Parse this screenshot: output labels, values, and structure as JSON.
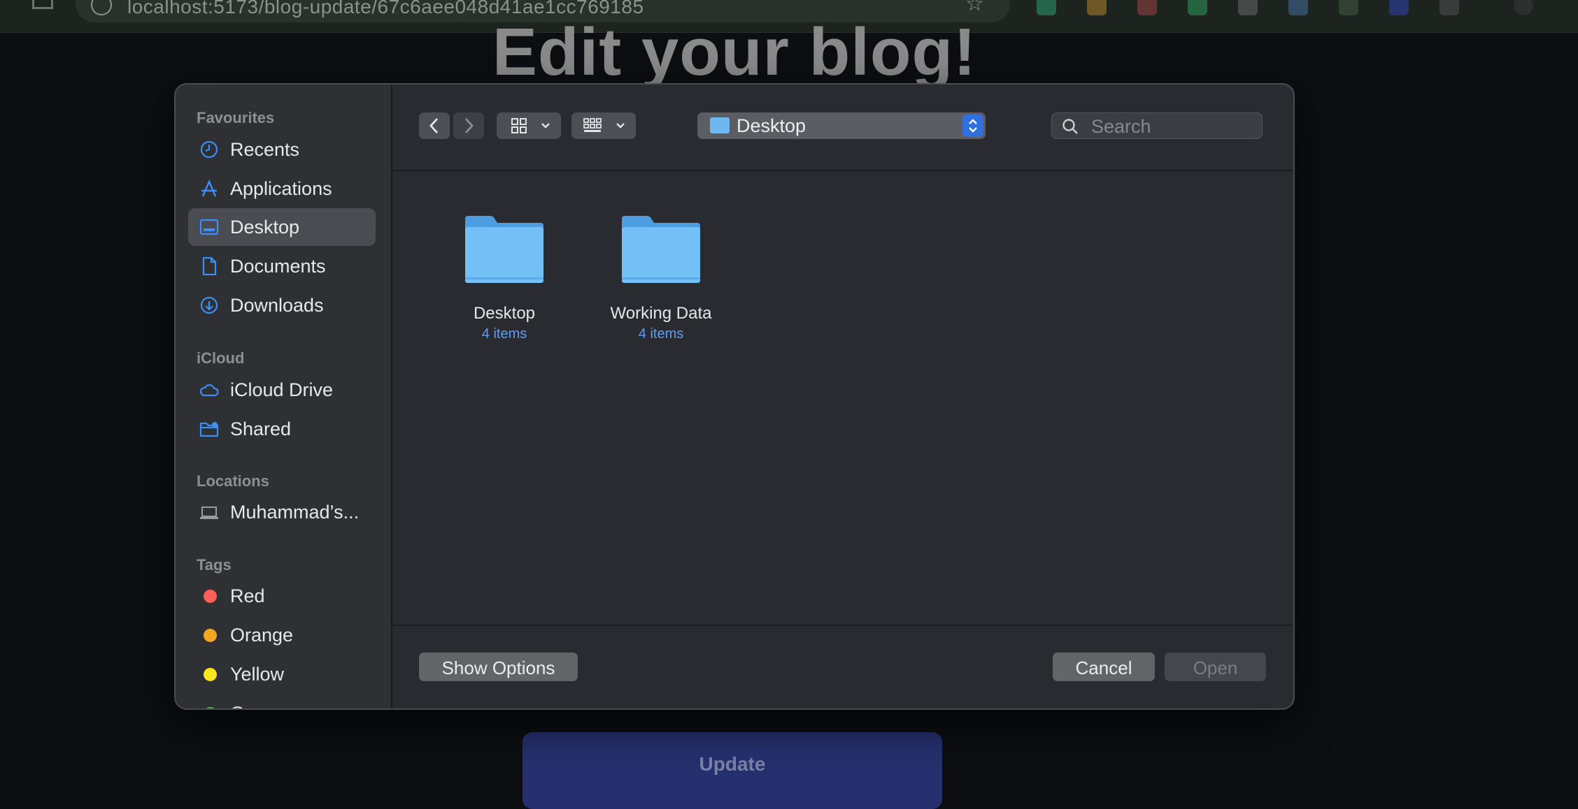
{
  "browser": {
    "url": "localhost:5173/blog-update/67c6aee048d41ae1cc769185"
  },
  "page": {
    "heading": "Edit your blog!",
    "update_label": "Update"
  },
  "dialog": {
    "sidebar": {
      "favourites_heading": "Favourites",
      "favourites": [
        {
          "label": "Recents",
          "icon": "clock-icon"
        },
        {
          "label": "Applications",
          "icon": "applications-icon"
        },
        {
          "label": "Desktop",
          "icon": "desktop-icon",
          "selected": true
        },
        {
          "label": "Documents",
          "icon": "document-icon"
        },
        {
          "label": "Downloads",
          "icon": "download-icon"
        }
      ],
      "icloud_heading": "iCloud",
      "icloud": [
        {
          "label": "iCloud Drive",
          "icon": "cloud-icon"
        },
        {
          "label": "Shared",
          "icon": "shared-folder-icon"
        }
      ],
      "locations_heading": "Locations",
      "locations": [
        {
          "label": "Muhammad’s...",
          "icon": "laptop-icon"
        }
      ],
      "tags_heading": "Tags",
      "tags": [
        {
          "label": "Red",
          "color": "#ff5f57"
        },
        {
          "label": "Orange",
          "color": "#f5a623"
        },
        {
          "label": "Yellow",
          "color": "#f8e71c"
        },
        {
          "label": "Green",
          "color": "#28c840"
        }
      ]
    },
    "toolbar": {
      "location": "Desktop",
      "search_placeholder": "Search"
    },
    "files": [
      {
        "name": "Desktop",
        "count": "4 items"
      },
      {
        "name": "Working Data",
        "count": "4 items"
      }
    ],
    "buttons": {
      "show_options": "Show Options",
      "cancel": "Cancel",
      "open": "Open"
    },
    "colors": {
      "accent": "#2f6fde",
      "folder": "#6fb8ef",
      "sidebar_icon": "#3b8ff6"
    }
  }
}
